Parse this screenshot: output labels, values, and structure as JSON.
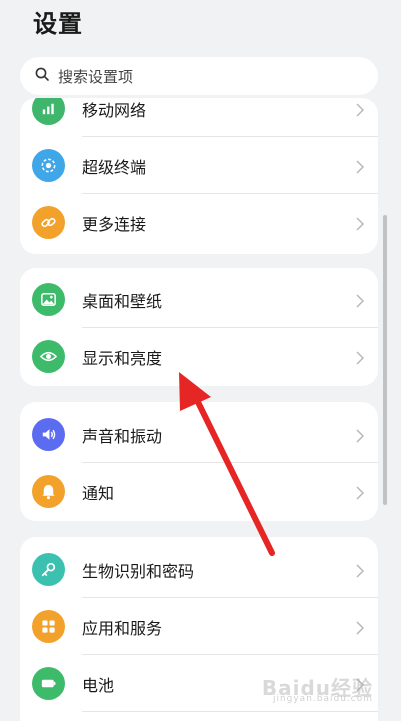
{
  "header": {
    "title": "设置"
  },
  "search": {
    "placeholder": "搜索设置项"
  },
  "groups": [
    {
      "items": [
        {
          "label": "移动网络",
          "icon": "mobile-network-icon",
          "color": "#3fb66b"
        },
        {
          "label": "超级终端",
          "icon": "super-device-icon",
          "color": "#3fa6e8"
        },
        {
          "label": "更多连接",
          "icon": "link-icon",
          "color": "#f2a12b"
        }
      ]
    },
    {
      "items": [
        {
          "label": "桌面和壁纸",
          "icon": "wallpaper-icon",
          "color": "#3dbb6a"
        },
        {
          "label": "显示和亮度",
          "icon": "eye-icon",
          "color": "#3dbb6a"
        }
      ]
    },
    {
      "items": [
        {
          "label": "声音和振动",
          "icon": "volume-icon",
          "color": "#5b6cf0"
        },
        {
          "label": "通知",
          "icon": "bell-icon",
          "color": "#f2a12b"
        }
      ]
    },
    {
      "items": [
        {
          "label": "生物识别和密码",
          "icon": "key-icon",
          "color": "#3cc1b1"
        },
        {
          "label": "应用和服务",
          "icon": "apps-icon",
          "color": "#f2a12b"
        },
        {
          "label": "电池",
          "icon": "battery-icon",
          "color": "#3dbb6a"
        }
      ]
    }
  ],
  "annotation": {
    "arrow_color": "#e62525"
  },
  "watermark": {
    "text": "Baidu经验",
    "sub": "jingyan.baidu.com"
  }
}
